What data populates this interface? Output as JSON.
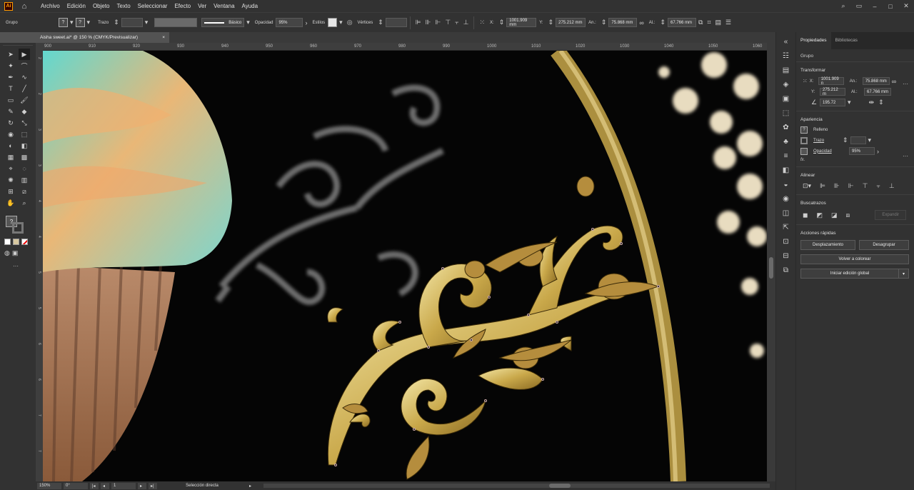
{
  "app": {
    "logo": "Ai"
  },
  "menu": [
    "Archivo",
    "Edición",
    "Objeto",
    "Texto",
    "Seleccionar",
    "Efecto",
    "Ver",
    "Ventana",
    "Ayuda"
  ],
  "control": {
    "object_type": "Grupo",
    "stroke_label": "Trazo",
    "brush_label": "Básico",
    "opacity_label": "Opacidad",
    "opacity_value": "95%",
    "style_label": "Estilos",
    "vertices_label": "Vértices",
    "x_label": "X:",
    "x_value": "1001.909 mm",
    "y_label": "Y:",
    "y_value": "275.212 mm",
    "w_label": "An.:",
    "w_value": "75.868 mm",
    "h_label": "Al.:",
    "h_value": "67.766 mm"
  },
  "document": {
    "tab_title": "Aisha sweet.ai* @ 150 % (CMYK/Previsualizar)",
    "close": "×"
  },
  "ruler": {
    "top_ticks": [
      "900",
      "910",
      "920",
      "930",
      "940",
      "950",
      "960",
      "970",
      "980",
      "990",
      "1000",
      "1010",
      "1020",
      "1030",
      "1040",
      "1050",
      "1060"
    ],
    "left_ticks": [
      "2",
      "2",
      "3",
      "3",
      "4",
      "4",
      "5",
      "5",
      "6",
      "6",
      "7",
      "7"
    ]
  },
  "status": {
    "zoom": "150%",
    "rotation": "0°",
    "artboard": "1",
    "tool": "Selección directa"
  },
  "panel": {
    "tabs": [
      "Propiedades",
      "Bibliotecas"
    ],
    "selection_type": "Grupo",
    "transform": {
      "title": "Transformar",
      "x_label": "X:",
      "x": "1001.909 n",
      "y_label": "Y:",
      "y": "275.212 m",
      "w_label": "An.:",
      "w": "75.868 mm",
      "h_label": "Al.:",
      "h": "67.766 mm",
      "angle": "195.72"
    },
    "appearance": {
      "title": "Apariencia",
      "fill": "Relleno",
      "stroke": "Trazo",
      "opacity_label": "Opacidad",
      "opacity": "95%",
      "fx": "fx."
    },
    "align": {
      "title": "Alinear"
    },
    "pathfinder": {
      "title": "Buscatrazos",
      "expand": "Expandir"
    },
    "quick_actions": {
      "title": "Acciones rápidas",
      "offset": "Desplazamiento",
      "ungroup": "Desagrupar",
      "recolor": "Volver a colorear",
      "global_edit": "Iniciar edición global"
    }
  },
  "colors": {
    "gold": "#c9a84a",
    "accent": "#ff9a00",
    "chrome": "#323232"
  }
}
